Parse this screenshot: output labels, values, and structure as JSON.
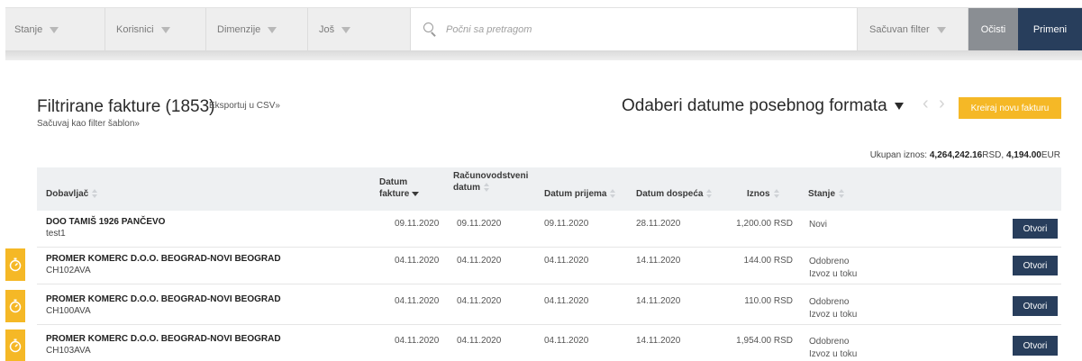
{
  "filter_bar": {
    "status_label": "Stanje",
    "users_label": "Korisnici",
    "dimensions_label": "Dimenzije",
    "more_label": "Još",
    "search_placeholder": "Počni sa pretragom",
    "saved_filter_label": "Sačuvan filter",
    "clear_label": "Očisti",
    "apply_label": "Primeni"
  },
  "header": {
    "title": "Filtrirane fakture (1853)",
    "export_link": "Eksportuj u CSV»",
    "save_filter_link": "Sačuvaj kao filter šablon»",
    "date_selector": "Odaberi datume posebnog formata",
    "prev_icon": "‹",
    "next_icon": "›",
    "create_button": "Kreiraj novu fakturu",
    "total_label": "Ukupan iznos:",
    "total_rsd": "4,264,242.16",
    "rsd_unit": "RSD,",
    "total_eur": "4,194.00",
    "eur_unit": "EUR"
  },
  "table": {
    "columns": {
      "supplier": "Dobavljač",
      "invoice_date_1": "Datum",
      "invoice_date_2": "fakture",
      "accounting_date_1": "Računovodstveni",
      "accounting_date_2": "datum",
      "received_date": "Datum prijema",
      "due_date": "Datum dospeća",
      "amount": "Iznos",
      "status": "Stanje"
    },
    "open_label": "Otvori",
    "rows": [
      {
        "supplier": "DOO TAMIŠ 1926 PANČEVO",
        "code": "test1",
        "invoice_date": "09.11.2020",
        "accounting_date": "09.11.2020",
        "received_date": "09.11.2020",
        "due_date": "28.11.2020",
        "amount": "1,200.00 RSD",
        "status_1": "Novi",
        "status_2": "",
        "flag": false
      },
      {
        "supplier": "PROMER KOMERC D.O.O. BEOGRAD-NOVI BEOGRAD",
        "code": "CH102AVA",
        "invoice_date": "04.11.2020",
        "accounting_date": "04.11.2020",
        "received_date": "04.11.2020",
        "due_date": "14.11.2020",
        "amount": "144.00 RSD",
        "status_1": "Odobreno",
        "status_2": "Izvoz u toku",
        "flag": true
      },
      {
        "supplier": "PROMER KOMERC D.O.O. BEOGRAD-NOVI BEOGRAD",
        "code": "CH100AVA",
        "invoice_date": "04.11.2020",
        "accounting_date": "04.11.2020",
        "received_date": "04.11.2020",
        "due_date": "14.11.2020",
        "amount": "110.00 RSD",
        "status_1": "Odobreno",
        "status_2": "Izvoz u toku",
        "flag": true
      },
      {
        "supplier": "PROMER KOMERC D.O.O. BEOGRAD-NOVI BEOGRAD",
        "code": "CH103AVA",
        "invoice_date": "04.11.2020",
        "accounting_date": "04.11.2020",
        "received_date": "04.11.2020",
        "due_date": "14.11.2020",
        "amount": "1,954.00 RSD",
        "status_1": "Odobreno",
        "status_2": "Izvoz u toku",
        "flag": true
      }
    ]
  },
  "colors": {
    "primary_navy": "#283e5c",
    "accent_yellow": "#f5b826",
    "clear_gray": "#8a8e93",
    "header_row_bg": "#eef0f2"
  },
  "icons": {
    "search": "search-icon",
    "dropdown": "caret-down-icon",
    "sort": "sort-icon",
    "flag": "stopwatch-icon"
  }
}
